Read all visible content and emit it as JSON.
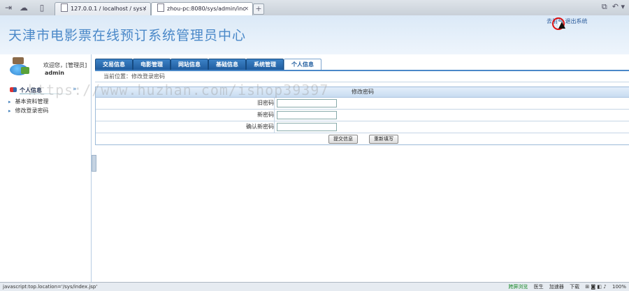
{
  "browser": {
    "tabs": [
      {
        "title": "127.0.0.1 / localhost / sys /"
      },
      {
        "title": "zhou-pc:8080/sys/admin/inc"
      }
    ],
    "new_tab": "+"
  },
  "header": {
    "title": "天津市电影票在线预订系统管理员中心",
    "link_home": "去前台",
    "link_logout": "退出系统"
  },
  "user": {
    "welcome": "欢迎您，[管理员]",
    "name": "admin"
  },
  "sidebar": {
    "section": "个人信息",
    "toggle": "»",
    "items": [
      {
        "label": "基本资料管理"
      },
      {
        "label": "修改登录密码"
      }
    ]
  },
  "main": {
    "tabs": [
      {
        "label": "交易信息"
      },
      {
        "label": "电影管理"
      },
      {
        "label": "网站信息"
      },
      {
        "label": "基础信息"
      },
      {
        "label": "系统管理"
      },
      {
        "label": "个人信息"
      }
    ],
    "breadcrumb": "当前位置：修改登录密码",
    "form": {
      "title": "修改密码",
      "old_password_label": "旧密码",
      "new_password_label": "新密码",
      "confirm_password_label": "确认新密码",
      "submit_label": "提交信息",
      "reset_label": "重新填写"
    }
  },
  "watermark": "https://www.huzhan.com/ishop39397",
  "status": {
    "url": "javascript:top.location='/sys/index.jsp'",
    "items": [
      "跨屏浏览",
      "医生",
      "加速器",
      "下载"
    ],
    "zoom": "100%"
  }
}
